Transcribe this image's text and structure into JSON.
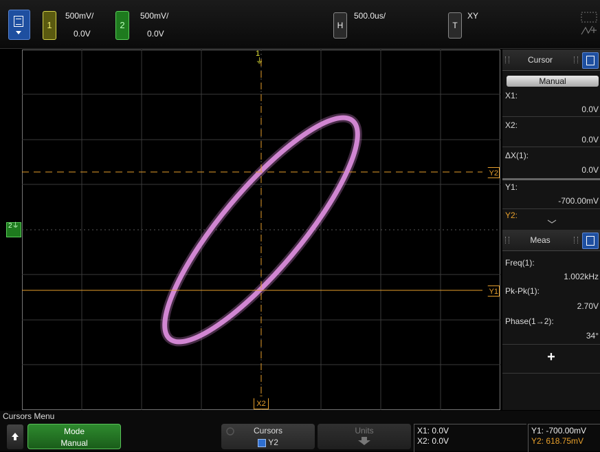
{
  "top": {
    "ch1": {
      "number": "1",
      "scale": "500mV/",
      "offset": "0.0V"
    },
    "ch2": {
      "number": "2",
      "scale": "500mV/",
      "offset": "0.0V"
    },
    "horizontal": {
      "label": "H",
      "scale": "500.0us/"
    },
    "trigger": {
      "label": "T",
      "mode": "XY"
    }
  },
  "display": {
    "markers": {
      "ch1_top": "1",
      "ch2_left": "2",
      "y2": "Y2",
      "y1": "Y1",
      "x2": "X2"
    },
    "colors": {
      "trace": "#c57ac6",
      "cursor": "#e8a02c",
      "ch1": "#e8e83a",
      "ch2": "#3ad93a",
      "grid": "#3a3a3a"
    }
  },
  "cursor_panel": {
    "title": "Cursor",
    "mode_button": "Manual",
    "x1_label": "X1:",
    "x1_value": "0.0V",
    "x2_label": "X2:",
    "x2_value": "0.0V",
    "dx_label": "ΔX(1):",
    "dx_value": "0.0V",
    "y1_label": "Y1:",
    "y1_value": "-700.00mV",
    "y2_label": "Y2:"
  },
  "meas_panel": {
    "title": "Meas",
    "freq_label": "Freq(1):",
    "freq_value": "1.002kHz",
    "pkpk_label": "Pk-Pk(1):",
    "pkpk_value": "2.70V",
    "phase_label": "Phase(1→2):",
    "phase_value": "34°",
    "add_label": "+"
  },
  "bottom": {
    "menu_label": "Cursors Menu",
    "mode_key": {
      "title": "Mode",
      "value": "Manual"
    },
    "cursors_key": {
      "title": "Cursors",
      "value": "Y2"
    },
    "units_key": {
      "title": "Units"
    },
    "readout_x1": "X1: 0.0V",
    "readout_x2": "X2: 0.0V",
    "readout_y1": "Y1: -700.00mV",
    "readout_y2": "Y2: 618.75mV"
  }
}
